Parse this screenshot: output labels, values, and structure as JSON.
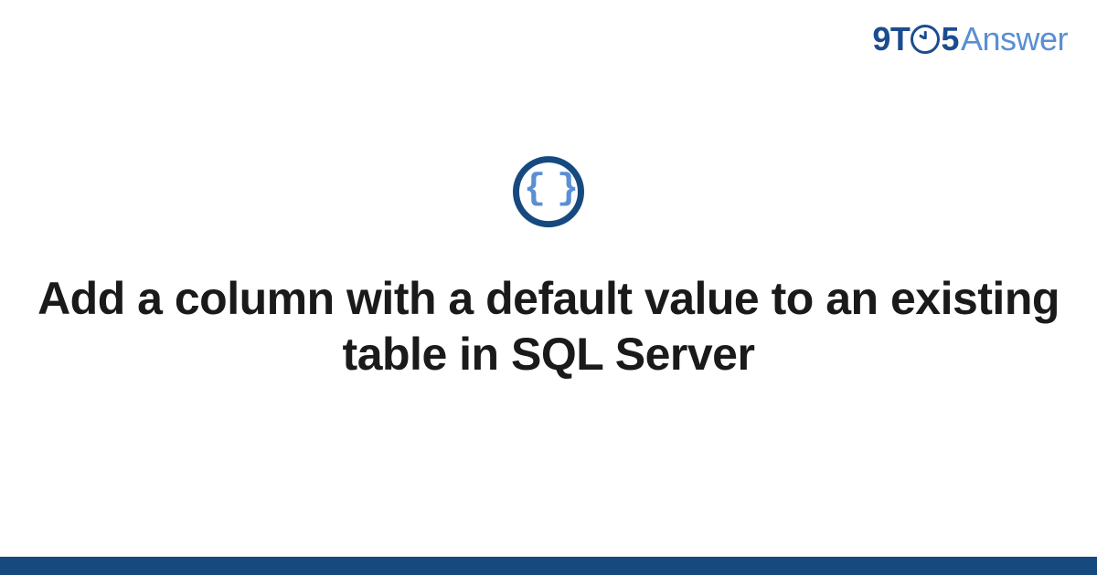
{
  "logo": {
    "part1": "9T",
    "part2": "5",
    "part3": "Answer"
  },
  "icon": {
    "braces": "{ }"
  },
  "title": "Add a column with a default value to an existing table in SQL Server",
  "colors": {
    "primary_dark": "#164a7f",
    "primary_light": "#5a8fd4",
    "text": "#1a1a1a"
  }
}
